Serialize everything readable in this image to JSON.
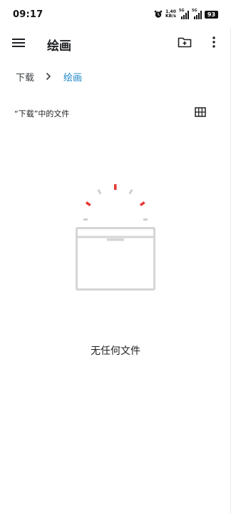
{
  "status_bar": {
    "time": "09:17",
    "net_speed_value": "1.40",
    "net_speed_unit": "KB/s",
    "sim1_network": "5G",
    "sim2_network": "5G",
    "battery": "93",
    "alarm_icon": "alarm-clock-icon"
  },
  "app_bar": {
    "title": "绘画",
    "menu_icon": "hamburger-menu-icon",
    "new_folder_icon": "create-folder-icon",
    "more_icon": "more-vertical-icon"
  },
  "breadcrumb": {
    "items": [
      "下载",
      "绘画"
    ],
    "separator_icon": "chevron-right-icon",
    "active_color": "#1e88c8"
  },
  "section": {
    "title": "“下载”中的文件",
    "view_toggle_icon": "grid-view-icon"
  },
  "empty_state": {
    "message": "无任何文件",
    "illustration_icon": "empty-box-icon",
    "accent_color": "#e53935"
  }
}
